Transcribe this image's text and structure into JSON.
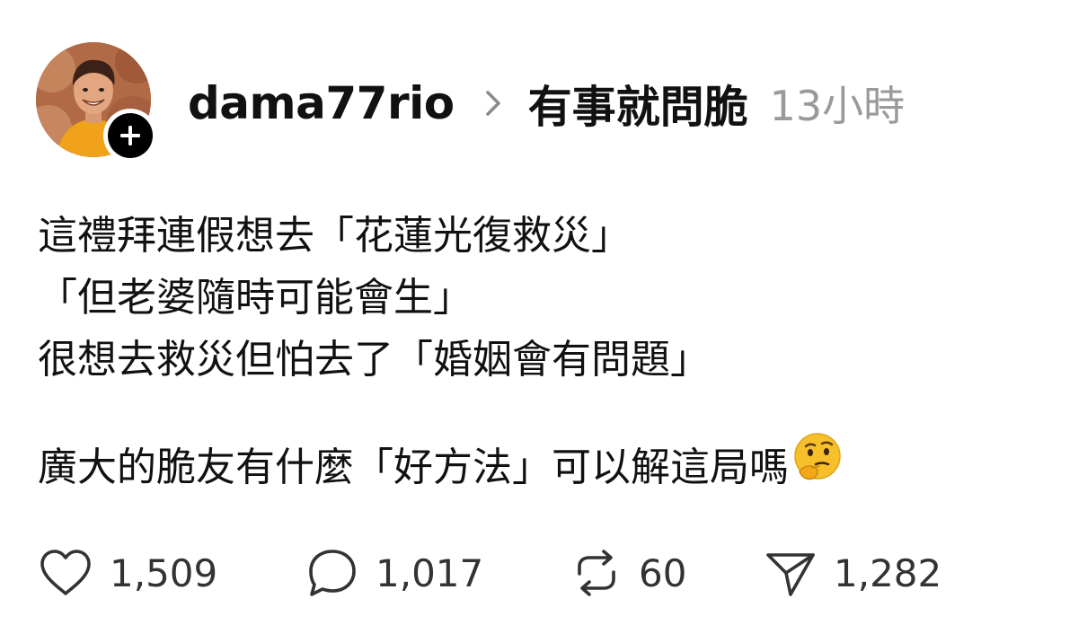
{
  "post": {
    "author": "dama77rio",
    "community": "有事就問脆",
    "time": "13小時",
    "lines": [
      "這禮拜連假想去「花蓮光復救災」",
      "「但老婆隨時可能會生」",
      "很想去救災但怕去了「婚姻會有問題」",
      "廣大的脆友有什麼「好方法」可以解這局嗎"
    ],
    "emoji": "thinking-face"
  },
  "actions": {
    "like_count": "1,509",
    "comment_count": "1,017",
    "repost_count": "60",
    "share_count": "1,282"
  },
  "icons": {
    "avatar": "user-avatar-photo",
    "follow": "plus-icon",
    "separator": "chevron-right-icon",
    "like": "heart-icon",
    "comment": "comment-bubble-icon",
    "repost": "repost-icon",
    "share": "send-icon"
  },
  "colors": {
    "text": "#111111",
    "muted": "#9a9a9a",
    "count": "#333333",
    "emoji_face": "#F7C02B",
    "follow_badge": "#000000"
  }
}
